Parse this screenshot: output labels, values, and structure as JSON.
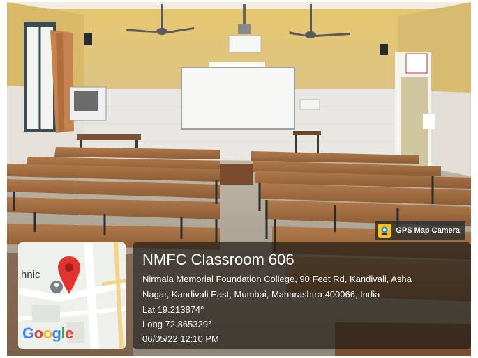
{
  "badge": {
    "label": "GPS Map Camera",
    "icon": "gps-map-camera-icon"
  },
  "map": {
    "place_fragment": "hnic",
    "brand": "Google",
    "pin_icon": "map-pin-icon"
  },
  "location": {
    "title": "NMFC Classroom 606",
    "address_line1": "Nirmala Memorial Foundation College, 90 Feet Rd, Kandivali, Asha",
    "address_line2": "Nagar, Kandivali East, Mumbai, Maharashtra 400066, India",
    "lat": "Lat 19.213874°",
    "long": "Long 72.865329°",
    "datetime": "06/05/22 12:10 PM"
  },
  "colors": {
    "pin": "#e2342c",
    "badge_bg": "#282828",
    "badge_icon": "#f6c21a",
    "panel_bg": "#231e19"
  }
}
